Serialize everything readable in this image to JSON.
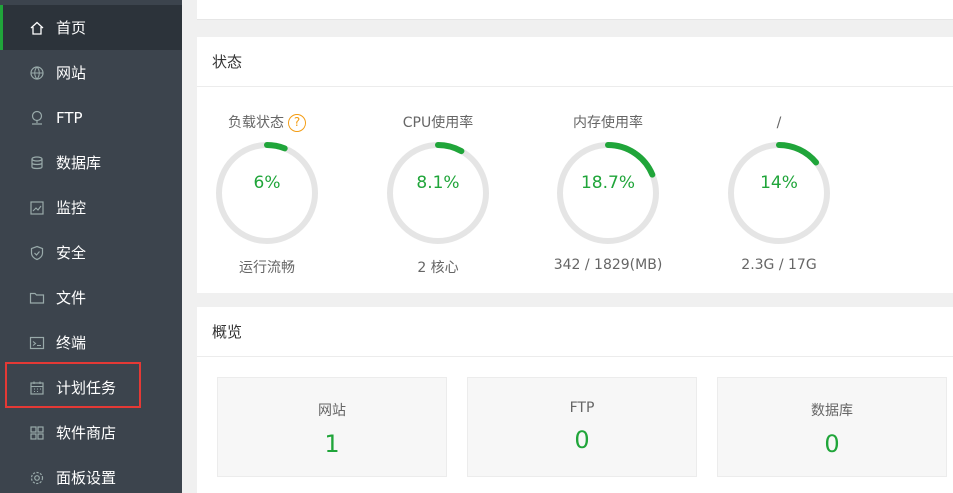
{
  "sidebar": {
    "items": [
      {
        "label": "首页",
        "icon": "home-icon",
        "active": true
      },
      {
        "label": "网站",
        "icon": "globe-icon"
      },
      {
        "label": "FTP",
        "icon": "ftp-icon"
      },
      {
        "label": "数据库",
        "icon": "database-icon"
      },
      {
        "label": "监控",
        "icon": "monitor-chart-icon"
      },
      {
        "label": "安全",
        "icon": "shield-icon"
      },
      {
        "label": "文件",
        "icon": "folder-icon"
      },
      {
        "label": "终端",
        "icon": "terminal-icon"
      },
      {
        "label": "计划任务",
        "icon": "calendar-icon"
      },
      {
        "label": "软件商店",
        "icon": "apps-grid-icon"
      },
      {
        "label": "面板设置",
        "icon": "gear-icon"
      }
    ]
  },
  "status": {
    "title": "状态",
    "gauges": [
      {
        "label": "负载状态",
        "value": "6%",
        "percent": 6,
        "sub": "运行流畅",
        "help": "?"
      },
      {
        "label": "CPU使用率",
        "value": "8.1%",
        "percent": 8.1,
        "sub": "2 核心"
      },
      {
        "label": "内存使用率",
        "value": "18.7%",
        "percent": 18.7,
        "sub": "342 / 1829(MB)"
      },
      {
        "label": "/",
        "value": "14%",
        "percent": 14,
        "sub": "2.3G / 17G"
      }
    ]
  },
  "overview": {
    "title": "概览",
    "boxes": [
      {
        "label": "网站",
        "value": "1"
      },
      {
        "label": "FTP",
        "value": "0"
      },
      {
        "label": "数据库",
        "value": "0"
      }
    ]
  },
  "colors": {
    "accent": "#20a53a",
    "sidebar_bg": "#3c444d",
    "highlight": "#e53935",
    "help": "#f39c12",
    "track": "#e5e5e5"
  }
}
